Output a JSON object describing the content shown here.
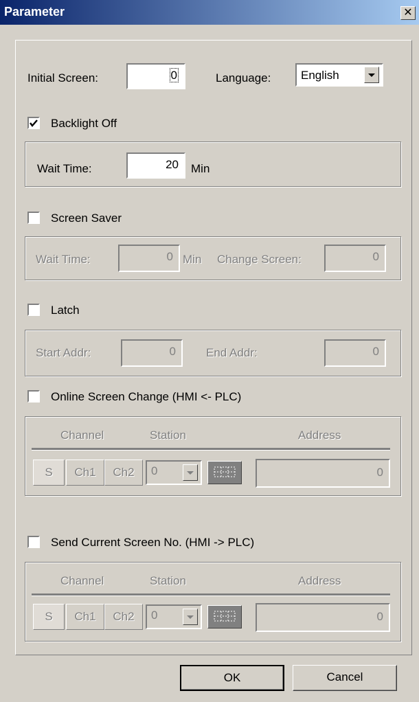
{
  "window": {
    "title": "Parameter",
    "close_glyph": "✕"
  },
  "general": {
    "initial_screen_label": "Initial Screen:",
    "initial_screen_value": "0",
    "language_label": "Language:",
    "language_value": "English"
  },
  "backlight": {
    "checkbox_label": "Backlight Off",
    "checked": true,
    "wait_time_label": "Wait Time:",
    "wait_time_value": "20",
    "wait_time_unit": "Min"
  },
  "screen_saver": {
    "checkbox_label": "Screen Saver",
    "checked": false,
    "wait_time_label": "Wait Time:",
    "wait_time_value": "0",
    "wait_time_unit": "Min",
    "change_screen_label": "Change Screen:",
    "change_screen_value": "0"
  },
  "latch": {
    "checkbox_label": "Latch",
    "checked": false,
    "start_label": "Start Addr:",
    "start_value": "0",
    "end_label": "End Addr:",
    "end_value": "0"
  },
  "online_change": {
    "checkbox_label": "Online Screen Change (HMI <- PLC)",
    "checked": false,
    "channel_header": "Channel",
    "station_header": "Station",
    "address_header": "Address",
    "btn_s": "S",
    "btn_ch1": "Ch1",
    "btn_ch2": "Ch2",
    "station_value": "0",
    "address_value": "0"
  },
  "send_current": {
    "checkbox_label": "Send Current Screen No. (HMI -> PLC)",
    "checked": false,
    "channel_header": "Channel",
    "station_header": "Station",
    "address_header": "Address",
    "btn_s": "S",
    "btn_ch1": "Ch1",
    "btn_ch2": "Ch2",
    "station_value": "0",
    "address_value": "0"
  },
  "buttons": {
    "ok": "OK",
    "cancel": "Cancel"
  },
  "icons": {
    "checkmark": "check-icon",
    "dropdown": "chevron-down-icon",
    "keypad": "keypad-icon"
  }
}
